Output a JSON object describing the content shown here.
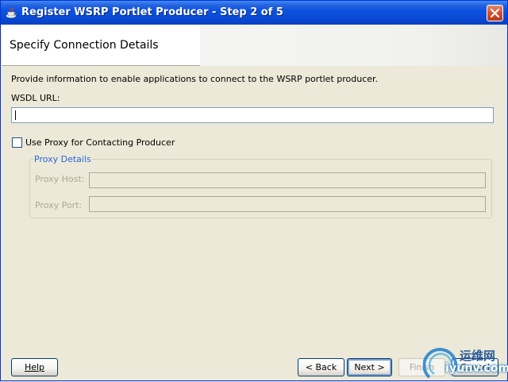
{
  "window": {
    "title": "Register WSRP Portlet Producer - Step 2 of 5",
    "icons": {
      "app": "coffee-cup-icon",
      "close": "close-icon"
    }
  },
  "header": {
    "title": "Specify Connection Details"
  },
  "body": {
    "description": "Provide information to enable applications to connect to the WSRP portlet producer.",
    "wsdl_label": "WSDL URL:",
    "wsdl_value": "",
    "use_proxy_label": "Use Proxy for Contacting Producer",
    "use_proxy_checked": false,
    "proxy_group_label": "Proxy Details",
    "proxy_host_label": "Proxy Host:",
    "proxy_port_label": "Proxy Port:",
    "proxy_host_value": "",
    "proxy_port_value": ""
  },
  "footer": {
    "help": "Help",
    "back": "< Back",
    "next": "Next >",
    "finish": "Finish",
    "cancel": "Cancel"
  },
  "watermark": {
    "logo": "yunwei-logo",
    "text_cn": "运维网",
    "text_en": "iyunv.com"
  },
  "colors": {
    "title_bar": "#0A4BD6",
    "dialog_bg": "#ECE9D8",
    "group_label": "#2A66D8",
    "disabled_text": "#ACA899"
  }
}
